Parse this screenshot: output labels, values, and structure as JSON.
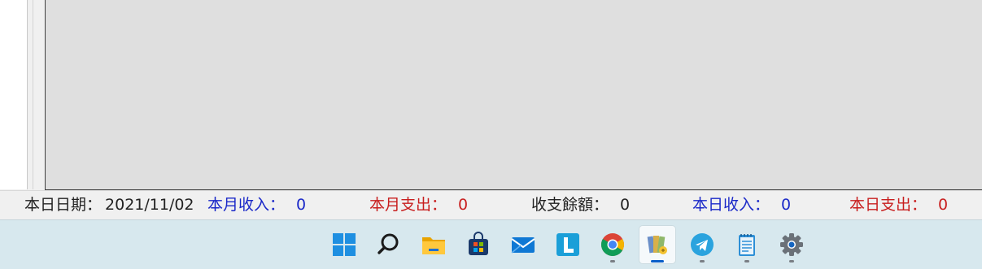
{
  "statusbar": {
    "today_date_label": "本日日期：",
    "today_date_value": "2021/11/02",
    "month_income_label": "本月收入：",
    "month_income_value": "0",
    "month_expense_label": "本月支出：",
    "month_expense_value": "0",
    "balance_label": "收支餘額：",
    "balance_value": "0",
    "today_income_label": "本日收入：",
    "today_income_value": "0",
    "today_expense_label": "本日支出：",
    "today_expense_value": "0"
  },
  "colors": {
    "income": "#1a28c8",
    "expense": "#c81e1e",
    "panel": "#dfdfdf",
    "taskbar": "#d7e8ee",
    "active_indicator": "#0a5fc9"
  },
  "taskbar": {
    "icons": [
      "windows-start-icon",
      "search-icon",
      "file-explorer-icon",
      "microsoft-store-icon",
      "mail-icon",
      "l-app-icon",
      "chrome-icon",
      "ledger-app-icon",
      "telegram-icon",
      "notepad-icon",
      "settings-icon"
    ],
    "active_app": "ledger-app-icon"
  }
}
